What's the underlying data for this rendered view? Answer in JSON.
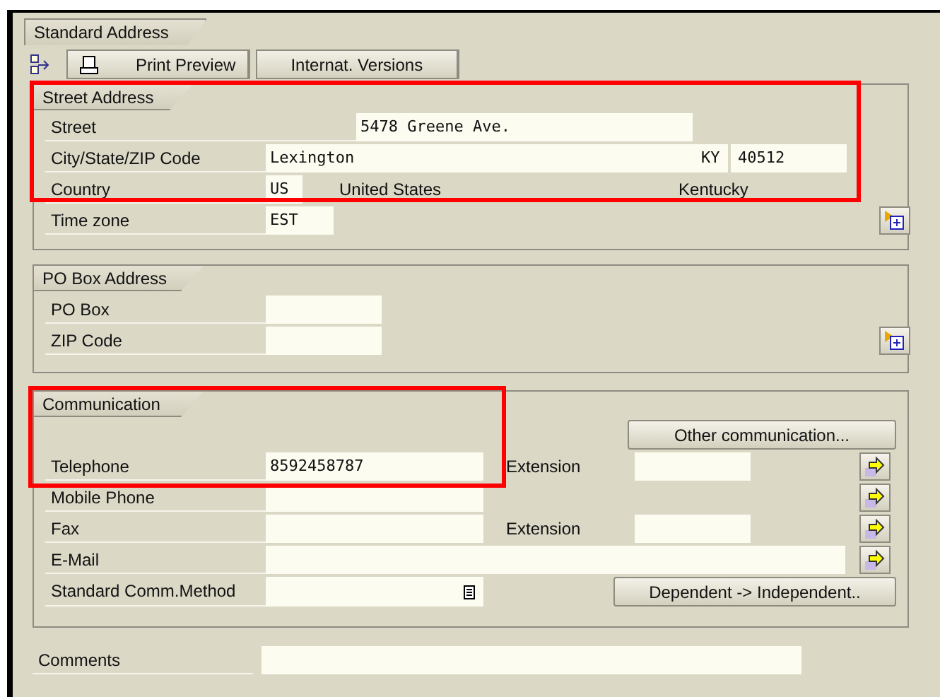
{
  "window": {
    "title": "Standard Address"
  },
  "toolbar": [
    {
      "kind": "icon"
    },
    {
      "kind": "button",
      "label": "Print Preview"
    },
    {
      "kind": "button",
      "label": "Internat. Versions"
    }
  ],
  "street_address": {
    "title": "Street Address",
    "highlighted": true,
    "street": {
      "label": "Street",
      "value": "5478 Greene Ave."
    },
    "city": {
      "label": "City/State/ZIP Code",
      "city": "Lexington",
      "state": "KY",
      "zip": "40512"
    },
    "country": {
      "label": "Country",
      "code": "US",
      "name": "United States",
      "region": "Kentucky"
    },
    "time_zone": {
      "label": "Time zone",
      "value": "EST"
    }
  },
  "po_box_address": {
    "title": "PO Box Address",
    "po_box": {
      "label": "PO Box"
    },
    "zip_code": {
      "label": "ZIP Code"
    }
  },
  "communication": {
    "title": "Communication",
    "highlighted": true,
    "other_button": "Other communication...",
    "rows": [
      {
        "kind": "phone",
        "label": "Telephone",
        "value": "8592458787",
        "extension_label": "Extension"
      },
      {
        "kind": "phone",
        "label": "Mobile Phone"
      },
      {
        "kind": "phone",
        "label": "Fax",
        "extension_label": "Extension"
      },
      {
        "kind": "email",
        "label": "E-Mail"
      }
    ],
    "method": {
      "label": "Standard Comm.Method"
    },
    "dependent_button": "Dependent -> Independent.."
  },
  "comments": {
    "label": "Comments"
  }
}
